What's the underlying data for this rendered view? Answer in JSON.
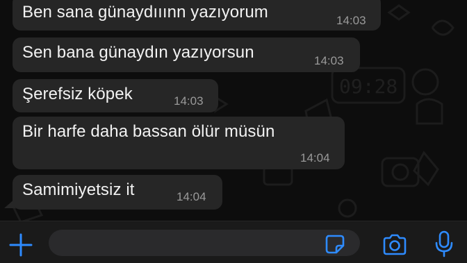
{
  "messages": [
    {
      "text": "Ben sana günaydııınn yazıyorum",
      "time": "14:03"
    },
    {
      "text": "Sen bana günaydın yazıyorsun",
      "time": "14:03"
    },
    {
      "text": "Şerefsiz köpek",
      "time": "14:03"
    },
    {
      "text": "Bir harfe daha bassan ölür müsün",
      "time": "14:04"
    },
    {
      "text": "Samimiyetsiz it",
      "time": "14:04"
    }
  ],
  "wallpaper_clock_text": "09:28",
  "input_bar": {
    "message_placeholder": "",
    "icons": [
      "plus-icon",
      "sticker-icon",
      "camera-icon",
      "microphone-icon"
    ]
  },
  "colors": {
    "accent": "#2e8bff",
    "bubble": "#262626",
    "background": "#0d0d0d",
    "timestamp": "#9a9a9a"
  }
}
